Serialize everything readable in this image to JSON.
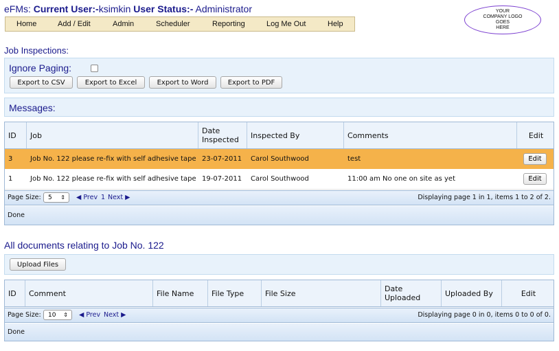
{
  "header": {
    "app_name": "eFMs:",
    "current_user_label": "Current User:-",
    "current_user": "ksimkin",
    "user_status_label": "User Status:-",
    "user_status": "Administrator"
  },
  "menu": {
    "items": [
      "Home",
      "Add / Edit",
      "Admin",
      "Scheduler",
      "Reporting",
      "Log Me Out",
      "Help"
    ]
  },
  "logo": {
    "lines": [
      "YOUR",
      "COMPANY LOGO",
      "GOES",
      "HERE"
    ]
  },
  "job_inspections": {
    "title": "Job Inspections:",
    "ignore_paging_label": "Ignore Paging:",
    "ignore_paging_checked": false,
    "export_buttons": [
      "Export to CSV",
      "Export to Excel",
      "Export to Word",
      "Export to PDF"
    ],
    "messages_label": "Messages:",
    "columns": [
      "ID",
      "Job",
      "Date Inspected",
      "Inspected By",
      "Comments",
      "Edit"
    ],
    "rows": [
      {
        "id": "3",
        "job": "Job No. 122 please re-fix with self adhesive tape",
        "date": "23-07-2011",
        "inspected_by": "Carol Southwood",
        "comments": "test",
        "edit": "Edit",
        "selected": true
      },
      {
        "id": "1",
        "job": "Job No. 122 please re-fix with self adhesive tape",
        "date": "19-07-2011",
        "inspected_by": "Carol Southwood",
        "comments": "11:00 am No one on site as yet",
        "edit": "Edit",
        "selected": false
      }
    ],
    "pager": {
      "page_size_label": "Page Size:",
      "page_size": "5",
      "prev": "Prev",
      "page": "1",
      "next": "Next",
      "summary": "Displaying page 1 in 1, items 1 to 2 of 2."
    },
    "status": "Done"
  },
  "documents": {
    "title": "All documents relating to Job No. 122",
    "upload_button": "Upload Files",
    "columns": [
      "ID",
      "Comment",
      "File Name",
      "File Type",
      "File Size",
      "Date Uploaded",
      "Uploaded By",
      "Edit"
    ],
    "pager": {
      "page_size_label": "Page Size:",
      "page_size": "10",
      "prev": "Prev",
      "next": "Next",
      "summary": "Displaying page 0 in 0, items 0 to 0 of 0."
    },
    "status": "Done"
  },
  "colors": {
    "title_blue": "#1a1a8c",
    "selected_row": "#f5b24a",
    "panel_bg": "#e8f2fb",
    "menu_bg": "#f4e9c6",
    "logo_border": "#7b3fd0"
  }
}
